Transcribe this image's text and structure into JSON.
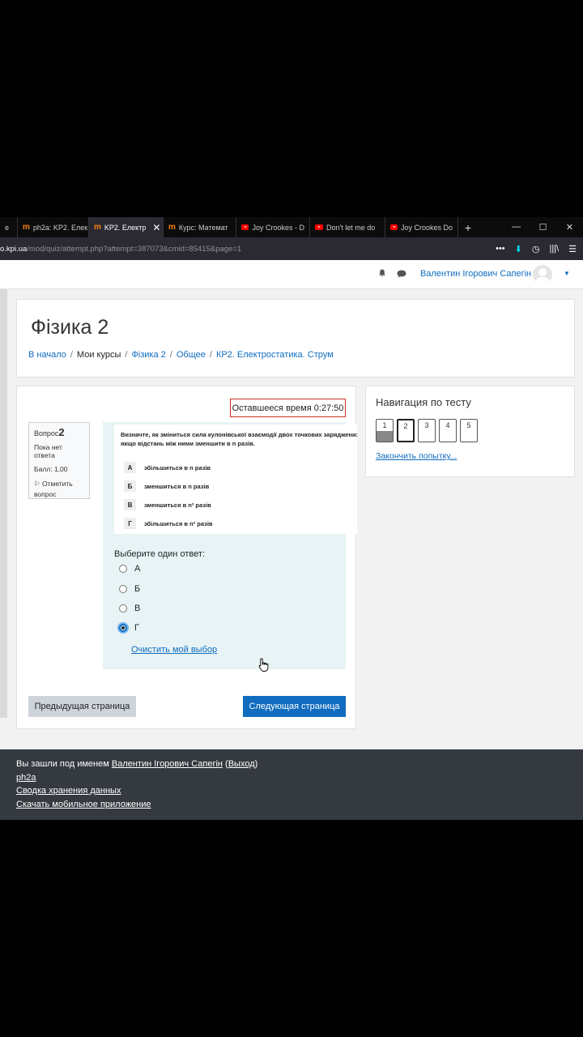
{
  "browser": {
    "tabs": [
      {
        "label": "е",
        "icon": "none"
      },
      {
        "label": "ph2a: KP2. Елек",
        "icon": "moodle-icon"
      },
      {
        "label": "KP2. Електр",
        "icon": "moodle-icon",
        "active": true
      },
      {
        "label": "Курс: Математ",
        "icon": "moodle-icon"
      },
      {
        "label": "Joy Crookes - D",
        "icon": "youtube-icon"
      },
      {
        "label": "Don't let me do",
        "icon": "youtube-icon"
      },
      {
        "label": "Joy Crookes Do",
        "icon": "youtube-icon"
      }
    ],
    "new_tab": "+",
    "window_controls": [
      "—",
      "☐",
      "✕"
    ],
    "url_host": "o.kpi.ua",
    "url_path": "/mod/quiz/attempt.php?attempt=387073&cmid=85415&page=1",
    "url_tools": [
      "•••",
      "⬇",
      "◷",
      "|||\\",
      "☰"
    ]
  },
  "navbar": {
    "user_name": "Валентин Ігорович Сапегін",
    "caret": "▼"
  },
  "header": {
    "course_title": "Фізика 2",
    "breadcrumb": [
      "В начало",
      "Мои курсы",
      "Фізика 2",
      "Общее",
      "КР2. Електростатика. Струм"
    ],
    "separator": "/"
  },
  "timer": {
    "text": "Оставшееся время 0:27:50"
  },
  "question_info": {
    "label": "Вопрос",
    "number": "2",
    "status": "Пока нет ответа",
    "score": "Балл: 1,00",
    "flag_label": "Отметить вопрос"
  },
  "question": {
    "text_line1": "Визначте, як зміниться сила кулонівської взаємодії двох точкових заряджених ті",
    "text_line2": "якщо відстань між ними зменшити в n разів.",
    "options": [
      {
        "letter": "А",
        "text": "збільшиться в n разів"
      },
      {
        "letter": "Б",
        "text": "зменшиться в n разів"
      },
      {
        "letter": "В",
        "text": "зменшиться в n² разів"
      },
      {
        "letter": "Г",
        "text": "збільшиться в n² разів"
      }
    ]
  },
  "answer": {
    "prompt": "Выберите один ответ:",
    "choices": [
      {
        "label": "А",
        "checked": false
      },
      {
        "label": "Б",
        "checked": false
      },
      {
        "label": "В",
        "checked": false
      },
      {
        "label": "Г",
        "checked": true
      }
    ],
    "clear_label": "Очистить мой выбор"
  },
  "buttons": {
    "prev": "Предыдущая страница",
    "next": "Следующая страница"
  },
  "quiz_nav": {
    "title": "Навигация по тесту",
    "questions": [
      {
        "number": "1",
        "state": "answered"
      },
      {
        "number": "2",
        "state": "current"
      },
      {
        "number": "3",
        "state": "normal"
      },
      {
        "number": "4",
        "state": "normal"
      },
      {
        "number": "5",
        "state": "normal"
      }
    ],
    "finish_label": "Закончить попытку..."
  },
  "footer": {
    "logged_in_prefix": "Вы зашли под именем",
    "user_name": "Валентин Ігорович Сапегін",
    "logout_label": "Выход",
    "course_short": "ph2a",
    "data_retention": "Сводка хранения данных",
    "mobile_app": "Скачать мобильное приложение"
  },
  "colors": {
    "primary": "#0f6cbf",
    "timer_border": "#ca3120",
    "footer_bg": "#343a40",
    "formulation_bg": "#e7f3f5"
  }
}
